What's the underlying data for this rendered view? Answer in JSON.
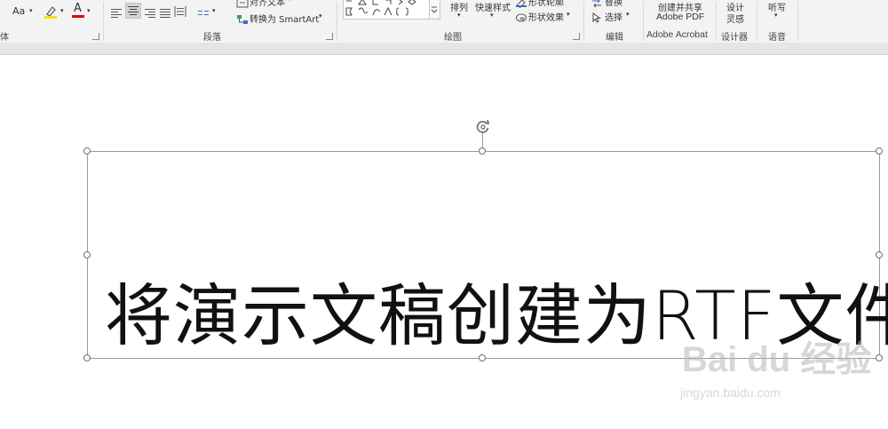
{
  "ribbon": {
    "font_group": {
      "label": "体",
      "font_size_btn": "Aa",
      "highlight_letter": "",
      "font_color_letter": "A",
      "colors": {
        "highlight": "#f5e400",
        "font": "#e00000"
      }
    },
    "paragraph_group": {
      "label": "段落",
      "align_text": "对齐文本",
      "convert_smartart": "转换为 SmartArt"
    },
    "drawing_group": {
      "label": "绘图",
      "arrange": "排列",
      "quick_styles": "快速样式",
      "shape_outline": "形状轮廓",
      "shape_effects": "形状效果"
    },
    "editing_group": {
      "label": "编辑",
      "replace": "替换",
      "select": "选择"
    },
    "acrobat_group": {
      "label": "Adobe Acrobat",
      "create_share_line1": "创建并共享",
      "create_share_line2": "Adobe PDF"
    },
    "designer_group": {
      "label": "设计器",
      "design_line1": "设计",
      "design_line2": "灵感"
    },
    "voice_group": {
      "label": "语音",
      "dictate": "听写"
    }
  },
  "slide": {
    "textbox_text": "将演示文稿创建为RTF文件"
  },
  "watermark": {
    "brand": "Bai du 经验",
    "url": "jingyan.baidu.com"
  }
}
